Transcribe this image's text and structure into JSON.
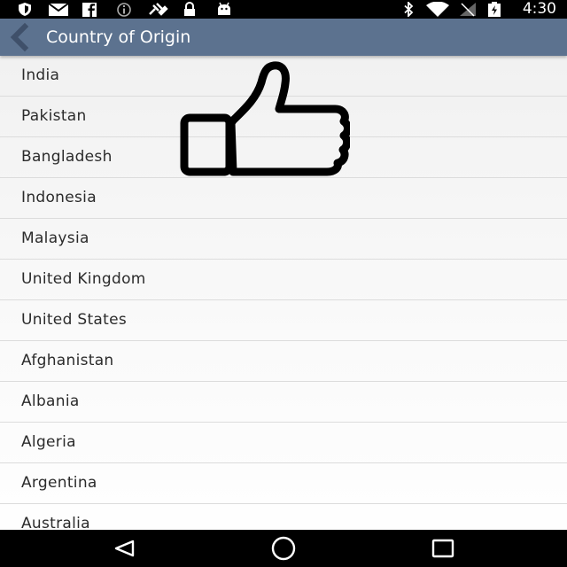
{
  "status_bar": {
    "time": "4:30",
    "icons": [
      "shield-icon",
      "mail-icon",
      "facebook-icon",
      "info-icon",
      "satellite-icon",
      "lock-icon",
      "android-icon",
      "bluetooth-icon",
      "wifi-icon",
      "no-signal-icon",
      "battery-icon"
    ]
  },
  "action_bar": {
    "title": "Country of Origin",
    "back_icon": "chevron-left-icon",
    "color": "#5c728f"
  },
  "countries": [
    "India",
    "Pakistan",
    "Bangladesh",
    "Indonesia",
    "Malaysia",
    "United Kingdom",
    "United States",
    "Afghanistan",
    "Albania",
    "Algeria",
    "Argentina",
    "Australia"
  ],
  "overlay": {
    "icon": "thumbs-up-icon"
  },
  "nav_bar": {
    "buttons": [
      "back-triangle-icon",
      "home-circle-icon",
      "recents-square-icon"
    ]
  }
}
